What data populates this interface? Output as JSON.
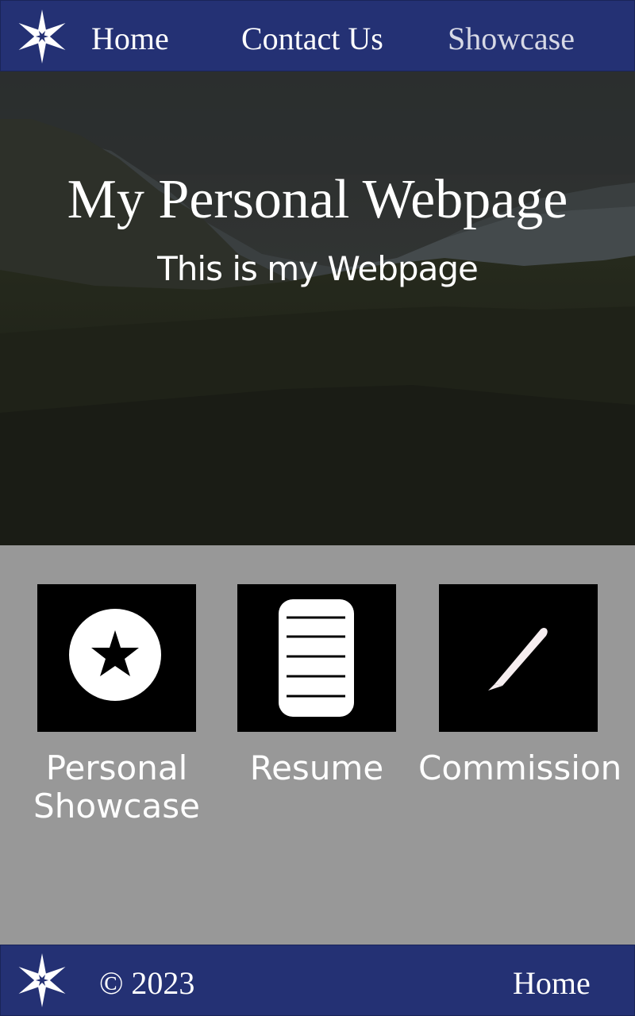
{
  "nav": {
    "logo_icon": "six-point-star-logo",
    "links": [
      {
        "label": "Home"
      },
      {
        "label": "Contact Us"
      },
      {
        "label": "Showcase"
      }
    ],
    "background_color": "#243174"
  },
  "hero": {
    "title": "My Personal Webpage",
    "subtitle": "This is my Webpage",
    "background_image": "dark mountain landscape"
  },
  "cards": [
    {
      "label": "Personal Showcase",
      "icon": "star-badge-icon"
    },
    {
      "label": "Resume",
      "icon": "document-icon"
    },
    {
      "label": "Commission",
      "icon": "pen-icon"
    }
  ],
  "footer": {
    "logo_icon": "six-point-star-logo",
    "copyright": "© 2023",
    "home_link": "Home"
  },
  "colors": {
    "nav_blue": "#243174",
    "content_gray": "#989898",
    "card_black": "#000000"
  }
}
